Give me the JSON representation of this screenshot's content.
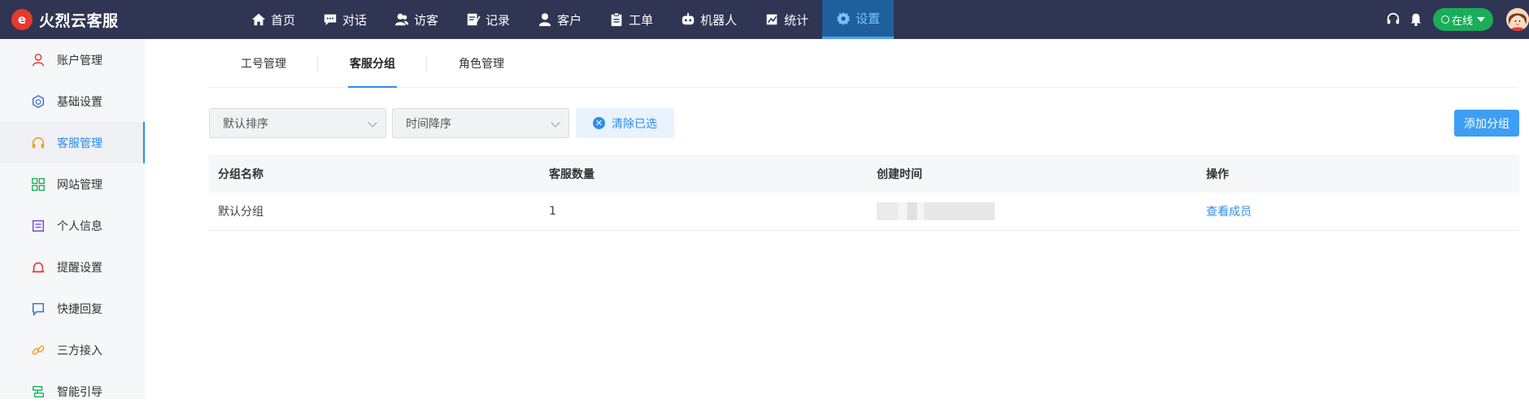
{
  "app": {
    "brand_logo_letter": "e",
    "brand_name": "火烈云客服",
    "brand_color": "#e8392f",
    "topbar_bg": "#2f3553",
    "accent": "#2d8cf0"
  },
  "nav": {
    "items": [
      {
        "label": "首页",
        "icon": "home-icon"
      },
      {
        "label": "对话",
        "icon": "chat-icon"
      },
      {
        "label": "访客",
        "icon": "visitors-icon"
      },
      {
        "label": "记录",
        "icon": "records-icon"
      },
      {
        "label": "客户",
        "icon": "customer-icon"
      },
      {
        "label": "工单",
        "icon": "ticket-icon"
      },
      {
        "label": "机器人",
        "icon": "robot-icon"
      },
      {
        "label": "统计",
        "icon": "stats-icon"
      },
      {
        "label": "设置",
        "icon": "settings-icon",
        "active": true
      }
    ]
  },
  "topright": {
    "headset_icon": "headset-icon",
    "bell_icon": "bell-icon",
    "status_label": "在线",
    "status_color": "#1aad5a"
  },
  "sidebar": {
    "items": [
      {
        "label": "账户管理",
        "icon": "user-icon",
        "color": "#e8392f"
      },
      {
        "label": "基础设置",
        "icon": "cube-icon",
        "color": "#3b6bd6"
      },
      {
        "label": "客服管理",
        "icon": "headset-icon",
        "color": "#f0a020",
        "active": true
      },
      {
        "label": "网站管理",
        "icon": "grid-icon",
        "color": "#1aad5a"
      },
      {
        "label": "个人信息",
        "icon": "id-card-icon",
        "color": "#6a4bd6"
      },
      {
        "label": "提醒设置",
        "icon": "alarm-icon",
        "color": "#e8392f"
      },
      {
        "label": "快捷回复",
        "icon": "message-icon",
        "color": "#3b6bd6"
      },
      {
        "label": "三方接入",
        "icon": "link-icon",
        "color": "#f0a020"
      },
      {
        "label": "智能引导",
        "icon": "guide-icon",
        "color": "#1aad5a"
      }
    ]
  },
  "tabs": [
    {
      "label": "工号管理"
    },
    {
      "label": "客服分组",
      "active": true
    },
    {
      "label": "角色管理"
    }
  ],
  "toolbar": {
    "sort_select": "默认排序",
    "time_select": "时间降序",
    "clear_label": "清除已选",
    "add_label": "添加分组"
  },
  "table": {
    "headers": [
      "分组名称",
      "客服数量",
      "创建时间",
      "操作"
    ],
    "rows": [
      {
        "name": "默认分组",
        "count": "1",
        "created": "",
        "action": "查看成员"
      }
    ]
  }
}
